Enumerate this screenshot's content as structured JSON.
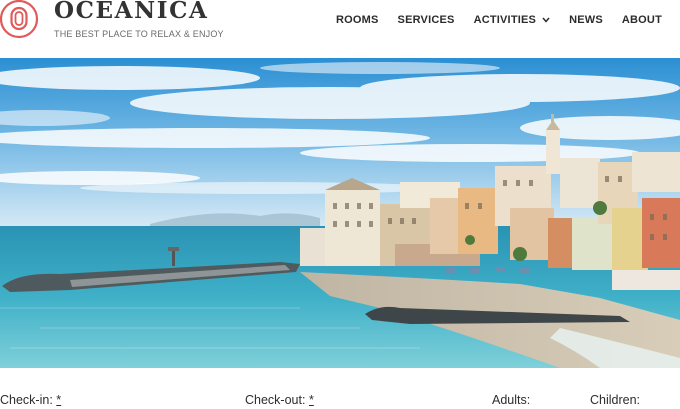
{
  "brand": {
    "name": "OCEANICA",
    "tagline": "THE BEST PLACE TO RELAX & ENJOY",
    "logo_icon": "concentric-circle-logo",
    "accent_color": "#e05a5a"
  },
  "nav": {
    "items": [
      {
        "label": "ROOMS"
      },
      {
        "label": "SERVICES"
      },
      {
        "label": "ACTIVITIES",
        "has_dropdown": true
      },
      {
        "label": "NEWS"
      },
      {
        "label": "ABOUT"
      }
    ]
  },
  "booking": {
    "checkin_label": "Check-in:",
    "checkout_label": "Check-out:",
    "required_marker": "*",
    "adults_label": "Adults:",
    "children_label": "Children:"
  }
}
